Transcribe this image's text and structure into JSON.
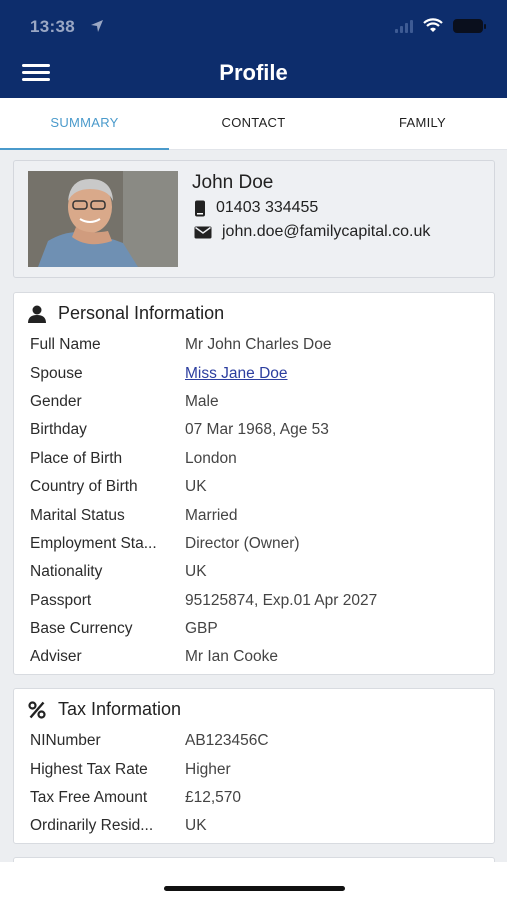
{
  "status_bar": {
    "time": "13:38"
  },
  "header": {
    "title": "Profile"
  },
  "tabs": [
    {
      "label": "SUMMARY",
      "active": true
    },
    {
      "label": "CONTACT",
      "active": false
    },
    {
      "label": "FAMILY",
      "active": false
    }
  ],
  "contact": {
    "name": "John Doe",
    "phone": "01403 334455",
    "email": "john.doe@familycapital.co.uk"
  },
  "personal": {
    "title": "Personal Information",
    "rows": [
      {
        "label": "Full Name",
        "value": "Mr John Charles Doe"
      },
      {
        "label": "Spouse",
        "value": "Miss Jane Doe"
      },
      {
        "label": "Gender",
        "value": "Male"
      },
      {
        "label": "Birthday",
        "value": "07 Mar 1968, Age 53"
      },
      {
        "label": "Place of Birth",
        "value": "London"
      },
      {
        "label": "Country of Birth",
        "value": "UK"
      },
      {
        "label": "Marital Status",
        "value": "Married"
      },
      {
        "label": "Employment Sta...",
        "value": "Director (Owner)"
      },
      {
        "label": "Nationality",
        "value": "UK"
      },
      {
        "label": "Passport",
        "value": "95125874, Exp.01 Apr 2027"
      },
      {
        "label": "Base Currency",
        "value": "GBP"
      },
      {
        "label": "Adviser",
        "value": "Mr Ian Cooke"
      }
    ]
  },
  "tax": {
    "title": "Tax Information",
    "rows": [
      {
        "label": "NINumber",
        "value": "AB123456C"
      },
      {
        "label": "Highest Tax Rate",
        "value": "Higher"
      },
      {
        "label": "Tax Free Amount",
        "value": "£12,570"
      },
      {
        "label": "Ordinarily Resid...",
        "value": "UK"
      }
    ]
  },
  "colors": {
    "header_bg": "#0d2d6c",
    "accent": "#4a9acb",
    "link": "#2c3e9f"
  }
}
